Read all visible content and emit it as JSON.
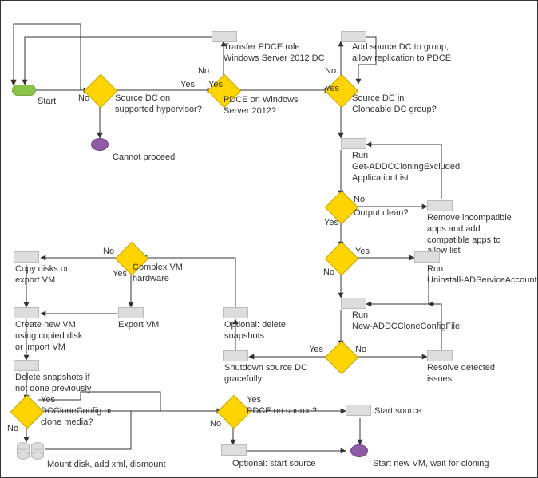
{
  "diagram": {
    "start": "Start",
    "q_hypervisor": "Source DC on\nsupported hypervisor?",
    "cannot_proceed": "Cannot proceed",
    "q_pdce2012": "PDCE on Windows\nServer 2012?",
    "transfer_pdce": "Transfer PDCE role\nWindows Server 2012 DC",
    "q_in_group": "Source DC in\nCloneable DC group?",
    "add_to_group": "Add source DC to group,\nallow replication to PDCE",
    "run_excluded": "Run\nGet-ADDCCloningExcluded\nApplicationList",
    "q_output_clean": "Output clean?",
    "remove_apps": "Remove incompatible\napps and add\ncompatible apps to\nallow list",
    "run_uninstall": "Run\nUninstall-ADServiceAccount",
    "run_newconfig": "Run\nNew-ADDCCloneConfigFile",
    "resolve_issues": "Resolve detected\nissues",
    "shutdown": "Shutdown source DC\ngracefully",
    "opt_snapshots": "Optional: delete\nsnapshots",
    "q_complex_hw": "Complex VM\nhardware",
    "copy_disks": "Copy disks or\nexport VM",
    "export_vm": "Export VM",
    "create_vm": "Create new VM\nusing copied disk\nor import VM",
    "delete_snapshots": "Delete snapshots if\nnot done previously",
    "q_dccloneconfig": "DCCloneConfig on\nclone media?",
    "mount_disk": "Mount disk, add xml, dismount",
    "q_pdce_on_source": "PDCE on source?",
    "start_source": "Start source",
    "opt_start_source": "Optional: start source",
    "start_new_vm": "Start new VM, wait for cloning"
  },
  "edges": {
    "yes": "Yes",
    "no": "No"
  }
}
